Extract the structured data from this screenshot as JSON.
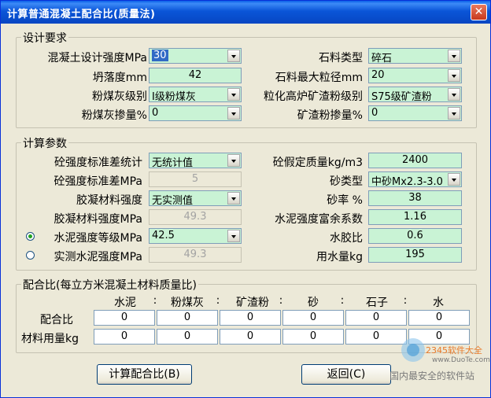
{
  "window": {
    "title": "计算普通混凝土配合比(质量法)",
    "close_glyph": "✕"
  },
  "design": {
    "legend": "设计要求",
    "strength_label": "混凝土设计强度MPa",
    "strength_value": "30",
    "stone_type_label": "石料类型",
    "stone_type_value": "碎石",
    "slump_label": "坍落度mm",
    "slump_value": "42",
    "max_size_label": "石料最大粒径mm",
    "max_size_value": "20",
    "flyash_grade_label": "粉煤灰级别",
    "flyash_grade_value": "Ⅰ级粉煤灰",
    "slag_grade_label": "粒化高炉矿渣粉级别",
    "slag_grade_value": "S75级矿渣粉",
    "flyash_dosage_label": "粉煤灰掺量%",
    "flyash_dosage_value": "0",
    "slag_dosage_label": "矿渣粉掺量%",
    "slag_dosage_value": "0"
  },
  "params": {
    "legend": "计算参数",
    "std_stat_label": "砼强度标准差统计",
    "std_stat_value": "无统计值",
    "assumed_mass_label": "砼假定质量kg/m3",
    "assumed_mass_value": "2400",
    "std_dev_label": "砼强度标准差MPa",
    "std_dev_value": "5",
    "sand_type_label": "砂类型",
    "sand_type_value": "中砂Mx2.3-3.0",
    "binder_strength_label": "胶凝材料强度",
    "binder_strength_value": "无实测值",
    "sand_ratio_label": "砂率 %",
    "sand_ratio_value": "38",
    "binder_mpa_label": "胶凝材料强度MPa",
    "binder_mpa_value": "49.3",
    "cement_coef_label": "水泥强度富余系数",
    "cement_coef_value": "1.16",
    "cement_grade_label": "水泥强度等级MPa",
    "cement_grade_value": "42.5",
    "wb_ratio_label": "水胶比",
    "wb_ratio_value": "0.6",
    "measured_label": "实测水泥强度MPa",
    "measured_value": "49.3",
    "water_label": "用水量kg",
    "water_value": "195"
  },
  "mix": {
    "legend": "配合比(每立方米混凝土材料质量比)",
    "headers": [
      "水泥",
      ":",
      "粉煤灰",
      ":",
      "矿渣粉",
      ":",
      "砂",
      ":",
      "石子",
      ":",
      "水"
    ],
    "ratio_label": "配合比",
    "ratio_values": [
      "0",
      "0",
      "0",
      "0",
      "0",
      "0"
    ],
    "usage_label": "材料用量kg",
    "usage_values": [
      "0",
      "0",
      "0",
      "0",
      "0",
      "0"
    ]
  },
  "buttons": {
    "calc": "计算配合比(B)",
    "back": "返回(C)"
  },
  "watermark": {
    "site": "www.DuoTe.com",
    "badge": "2345软件大全",
    "slogan": "国内最安全的软件站"
  },
  "colors": {
    "field_bg": "#c9f3d5",
    "title_bg": "#0a55d8"
  }
}
